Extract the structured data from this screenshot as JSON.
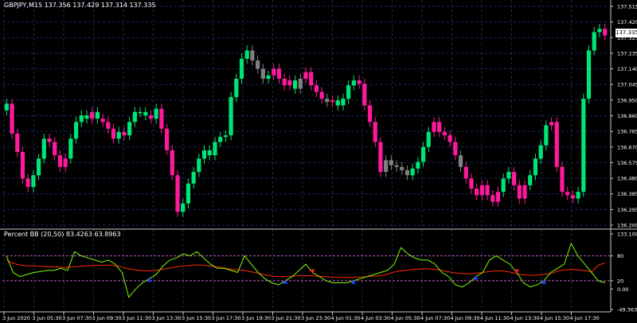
{
  "main_header": {
    "symbol": "GBPJPY,M15",
    "ohlc": "137.356 137.429 137.314 137.335"
  },
  "price_readout": "137.335",
  "price_axis_labels": [
    "137.515",
    "137.420",
    "137.325",
    "137.235",
    "137.140",
    "137.045",
    "136.950",
    "136.860",
    "136.765",
    "136.670",
    "136.575",
    "136.480",
    "136.385",
    "136.295",
    "136.200"
  ],
  "indicator": {
    "header": "Percent BB (20,50) 83.4263 63.8963",
    "axis_labels": [
      "133.1001",
      "80",
      "20",
      "0.00",
      "-49.3637"
    ]
  },
  "time_axis_labels": [
    "3 Jun 2020",
    "3 Jun 05:30",
    "3 Jun 07:30",
    "3 Jun 09:30",
    "3 Jun 11:30",
    "3 Jun 13:30",
    "3 Jun 15:30",
    "3 Jun 17:30",
    "3 Jun 19:30",
    "3 Jun 21:30",
    "3 Jun 23:30",
    "4 Jun 01:30",
    "4 Jun 03:30",
    "4 Jun 05:30",
    "4 Jun 07:30",
    "4 Jun 09:30",
    "4 Jun 11:30",
    "4 Jun 13:30",
    "4 Jun 15:30",
    "4 Jun 17:30"
  ],
  "colors": {
    "bull": "#00e676",
    "bear": "#ff1a9c",
    "neutral": "#808080",
    "grid": "#1b2a5e",
    "pb_line": "#7cfc00",
    "signal_line": "#ff2a00",
    "level_line": "#c060c0",
    "buy_arrow": "#2040ff",
    "sell_arrow": "#ff2020"
  },
  "chart_data": [
    {
      "type": "candlestick",
      "title": "GBPJPY,M15",
      "ylim": [
        136.2,
        137.515
      ],
      "closes": [
        136.93,
        136.75,
        136.64,
        136.48,
        136.43,
        136.5,
        136.6,
        136.72,
        136.7,
        136.62,
        136.55,
        136.6,
        136.72,
        136.82,
        136.86,
        136.84,
        136.88,
        136.84,
        136.82,
        136.78,
        136.72,
        136.76,
        136.74,
        136.82,
        136.88,
        136.88,
        136.86,
        136.84,
        136.9,
        136.78,
        136.65,
        136.5,
        136.28,
        136.33,
        136.45,
        136.52,
        136.6,
        136.65,
        136.62,
        136.7,
        136.73,
        136.74,
        136.97,
        137.08,
        137.2,
        137.25,
        137.19,
        137.14,
        137.08,
        137.1,
        137.14,
        137.08,
        137.04,
        137.07,
        137.02,
        137.08,
        137.12,
        137.04,
        137.0,
        136.96,
        136.94,
        136.95,
        136.92,
        136.96,
        137.04,
        137.07,
        137.05,
        136.92,
        136.82,
        136.7,
        136.52,
        136.59,
        136.56,
        136.55,
        136.53,
        136.5,
        136.54,
        136.58,
        136.67,
        136.76,
        136.82,
        136.76,
        136.74,
        136.7,
        136.62,
        136.55,
        136.48,
        136.42,
        136.38,
        136.44,
        136.38,
        136.34,
        136.4,
        136.48,
        136.52,
        136.44,
        136.36,
        136.44,
        136.5,
        136.6,
        136.68,
        136.8,
        136.82,
        136.55,
        136.4,
        136.38,
        136.36,
        136.4,
        136.96,
        137.25,
        137.36,
        137.38,
        137.34
      ],
      "bar_colors": "gbbbbgggbbbbggggbgbbbgbggggbgbbbbgggggggggggggnnngbbbbgnbbbbnbggggbbbbbnnnnnggggbbbbbnbbbbbbbggbbbggggbbbbbgggggb"
    },
    {
      "type": "line",
      "title": "Percent BB (20,50) 83.4263 63.8963",
      "ylim": [
        -49.3637,
        133.1001
      ],
      "series": [
        {
          "name": "Percent BB (20,50)",
          "values": [
            80,
            40,
            30,
            35,
            40,
            42,
            45,
            45,
            50,
            45,
            90,
            80,
            75,
            70,
            65,
            70,
            60,
            40,
            -20,
            0,
            15,
            25,
            35,
            55,
            70,
            75,
            85,
            80,
            90,
            75,
            60,
            50,
            50,
            45,
            40,
            80,
            60,
            40,
            25,
            15,
            10,
            20,
            30,
            45,
            60,
            40,
            30,
            20,
            15,
            15,
            15,
            20,
            25,
            30,
            35,
            40,
            45,
            60,
            100,
            85,
            75,
            70,
            70,
            60,
            40,
            30,
            10,
            5,
            15,
            30,
            40,
            70,
            80,
            70,
            60,
            40,
            15,
            5,
            10,
            20,
            40,
            50,
            60,
            110,
            80,
            60,
            40,
            20,
            15
          ]
        },
        {
          "name": "Signal",
          "values": [
            70,
            62,
            58,
            56,
            56,
            55,
            54,
            54,
            53,
            52,
            54,
            55,
            56,
            57,
            57,
            58,
            57,
            55,
            50,
            47,
            45,
            44,
            44,
            46,
            49,
            52,
            55,
            56,
            58,
            58,
            57,
            55,
            53,
            50,
            47,
            46,
            44,
            41,
            38,
            34,
            31,
            30,
            30,
            31,
            33,
            32,
            32,
            31,
            30,
            29,
            28,
            28,
            28,
            29,
            30,
            31,
            32,
            35,
            40,
            43,
            45,
            47,
            48,
            49,
            48,
            46,
            43,
            40,
            38,
            37,
            37,
            39,
            41,
            43,
            44,
            43,
            40,
            36,
            34,
            33,
            34,
            36,
            38,
            44,
            46,
            47,
            46,
            44,
            42,
            58,
            63
          ]
        }
      ],
      "levels": [
        80,
        20
      ]
    }
  ]
}
